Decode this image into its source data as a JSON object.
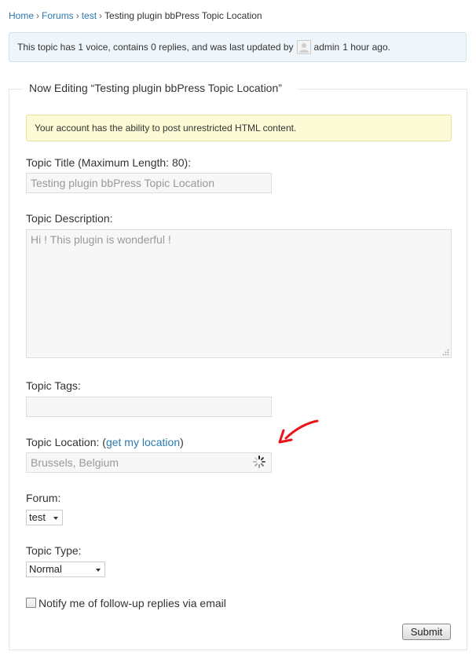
{
  "breadcrumb": {
    "items": [
      "Home",
      "Forums",
      "test"
    ],
    "current": "Testing plugin bbPress Topic Location",
    "separator": "›"
  },
  "info": {
    "text_before": "This topic has 1 voice, contains 0 replies, and was last updated by",
    "author": "admin",
    "time": "1 hour ago."
  },
  "form": {
    "legend": "Now Editing “Testing plugin bbPress Topic Location”",
    "html_notice": "Your account has the ability to post unrestricted HTML content.",
    "title_label": "Topic Title (Maximum Length: 80):",
    "title_value": "Testing plugin bbPress Topic Location",
    "description_label": "Topic Description:",
    "description_value": "Hi ! This plugin is wonderful !",
    "tags_label": "Topic Tags:",
    "tags_value": "",
    "location_label_prefix": "Topic Location: (",
    "location_link": "get my location",
    "location_label_suffix": ")",
    "location_value": "Brussels, Belgium",
    "forum_label": "Forum:",
    "forum_selected": "test",
    "type_label": "Topic Type:",
    "type_selected": "Normal",
    "notify_label": "Notify me of follow-up replies via email",
    "notify_checked": false,
    "submit_label": "Submit"
  },
  "icons": {
    "avatar": "avatar-icon",
    "spinner": "loading-spinner-icon",
    "annotation": "red-arrow-icon",
    "resize": "resize-grip-icon"
  },
  "colors": {
    "link": "#2a7ab0",
    "info_bg": "#eef6fc",
    "notice_bg": "#fdfbd6",
    "annotation_arrow": "#e8141a"
  }
}
